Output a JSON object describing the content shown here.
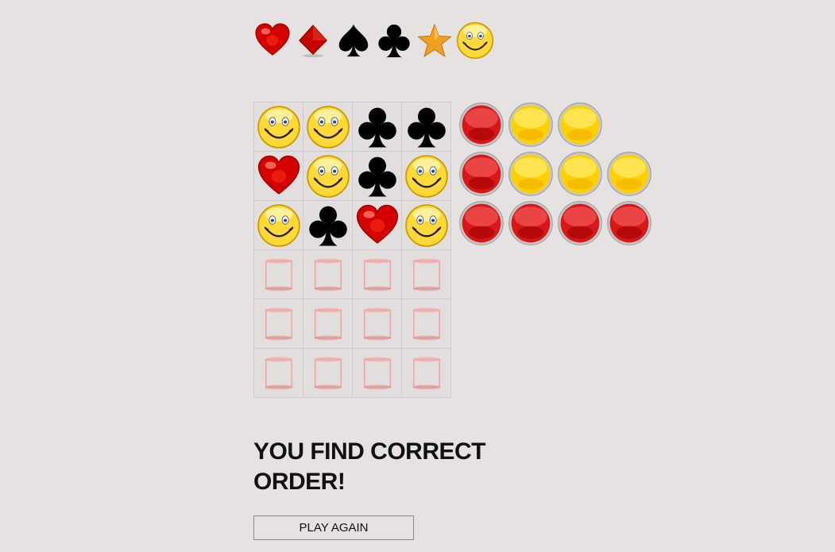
{
  "palette": [
    "heart",
    "diamond",
    "spade",
    "club",
    "star",
    "smiley"
  ],
  "board": [
    [
      "smiley",
      "smiley",
      "club",
      "club"
    ],
    [
      "heart",
      "smiley",
      "club",
      "smiley"
    ],
    [
      "smiley",
      "club",
      "heart",
      "smiley"
    ],
    [
      "empty",
      "empty",
      "empty",
      "empty"
    ],
    [
      "empty",
      "empty",
      "empty",
      "empty"
    ],
    [
      "empty",
      "empty",
      "empty",
      "empty"
    ]
  ],
  "feedback": [
    [
      "red",
      "yellow",
      "yellow"
    ],
    [
      "red",
      "yellow",
      "yellow",
      "yellow"
    ],
    [
      "red",
      "red",
      "red",
      "red"
    ]
  ],
  "message": "YOU FIND CORRECT ORDER!",
  "play_again_label": "PLAY AGAIN",
  "colors": {
    "background": "#e6e2e2",
    "red_peg": "#e02424",
    "yellow_peg": "#ffd600",
    "heart": "#d40000",
    "star": "#f0a020"
  }
}
